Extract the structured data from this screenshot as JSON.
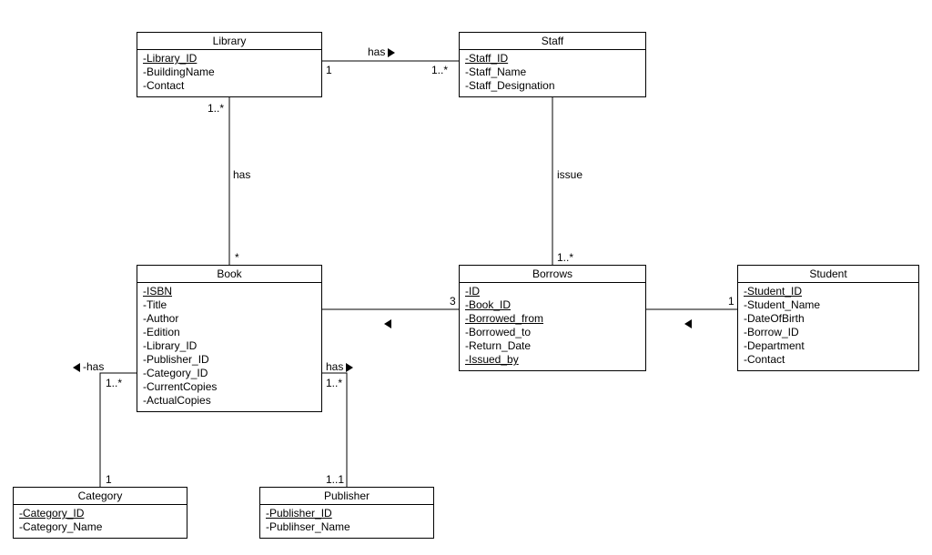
{
  "classes": {
    "library": {
      "name": "Library",
      "attrs": [
        {
          "text": "-Library_ID",
          "underline": true
        },
        {
          "text": "-BuildingName",
          "underline": false
        },
        {
          "text": "-Contact",
          "underline": false
        }
      ]
    },
    "staff": {
      "name": "Staff",
      "attrs": [
        {
          "text": "-Staff_ID",
          "underline": true
        },
        {
          "text": "-Staff_Name",
          "underline": false
        },
        {
          "text": "-Staff_Designation",
          "underline": false
        }
      ]
    },
    "book": {
      "name": "Book",
      "attrs": [
        {
          "text": "-ISBN",
          "underline": true
        },
        {
          "text": "-Title",
          "underline": false
        },
        {
          "text": "-Author",
          "underline": false
        },
        {
          "text": "-Edition",
          "underline": false
        },
        {
          "text": "-Library_ID",
          "underline": false
        },
        {
          "text": "-Publisher_ID",
          "underline": false
        },
        {
          "text": "-Category_ID",
          "underline": false
        },
        {
          "text": "-CurrentCopies",
          "underline": false
        },
        {
          "text": "-ActualCopies",
          "underline": false
        }
      ]
    },
    "borrows": {
      "name": "Borrows",
      "attrs": [
        {
          "text": "-ID",
          "underline": true
        },
        {
          "text": "-Book_ID",
          "underline": true
        },
        {
          "text": "-Borrowed_from",
          "underline": true
        },
        {
          "text": "-Borrowed_to",
          "underline": false
        },
        {
          "text": "-Return_Date",
          "underline": false
        },
        {
          "text": "-Issued_by",
          "underline": true
        }
      ]
    },
    "student": {
      "name": "Student",
      "attrs": [
        {
          "text": "-Student_ID",
          "underline": true
        },
        {
          "text": "-Student_Name",
          "underline": false
        },
        {
          "text": "-DateOfBirth",
          "underline": false
        },
        {
          "text": "-Borrow_ID",
          "underline": false
        },
        {
          "text": "-Department",
          "underline": false
        },
        {
          "text": "-Contact",
          "underline": false
        }
      ]
    },
    "category": {
      "name": "Category",
      "attrs": [
        {
          "text": "-Category_ID",
          "underline": true
        },
        {
          "text": "-Category_Name",
          "underline": false
        }
      ]
    },
    "publisher": {
      "name": "Publisher",
      "attrs": [
        {
          "text": "-Publisher_ID",
          "underline": true
        },
        {
          "text": "-Publihser_Name",
          "underline": false
        }
      ]
    }
  },
  "associations": {
    "library_staff": {
      "label": "has",
      "direction": "east",
      "end1": "1",
      "end2": "1..*"
    },
    "library_book": {
      "label": "has",
      "end1": "1..*",
      "end2": "*"
    },
    "staff_borrows": {
      "label": "issue",
      "end2": "1..*"
    },
    "book_borrows": {
      "direction": "west",
      "end1": "3"
    },
    "borrows_student": {
      "direction": "west",
      "end2": "1"
    },
    "book_category": {
      "label": "has",
      "direction": "west",
      "end1": "1..*",
      "end2": "1"
    },
    "book_publisher": {
      "label": "has",
      "direction": "east",
      "end1": "1..*",
      "end2": "1..1"
    }
  }
}
